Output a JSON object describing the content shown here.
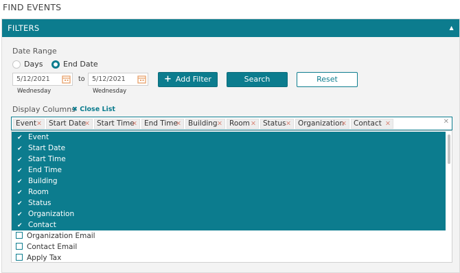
{
  "page_title": "FIND EVENTS",
  "filters": {
    "header": "FILTERS",
    "date_range_label": "Date Range",
    "radio_days": "Days",
    "radio_end_date": "End Date",
    "selected_radio": "End Date",
    "start_date": "5/12/2021",
    "start_weekday": "Wednesday",
    "to_label": "to",
    "end_date": "5/12/2021",
    "end_weekday": "Wednesday",
    "add_filter_label": "Add Filter",
    "search_label": "Search",
    "reset_label": "Reset",
    "display_columns_label": "Display Columns",
    "close_list_label": "Close List"
  },
  "tags": [
    "Event",
    "Start Date",
    "Start Time",
    "End Time",
    "Building",
    "Room",
    "Status",
    "Organization",
    "Contact"
  ],
  "options": [
    {
      "label": "Event",
      "selected": true
    },
    {
      "label": "Start Date",
      "selected": true
    },
    {
      "label": "Start Time",
      "selected": true
    },
    {
      "label": "End Time",
      "selected": true
    },
    {
      "label": "Building",
      "selected": true
    },
    {
      "label": "Room",
      "selected": true
    },
    {
      "label": "Status",
      "selected": true
    },
    {
      "label": "Organization",
      "selected": true
    },
    {
      "label": "Contact",
      "selected": true
    },
    {
      "label": "Organization Email",
      "selected": false
    },
    {
      "label": "Contact Email",
      "selected": false
    },
    {
      "label": "Apply Tax",
      "selected": false
    }
  ],
  "colors": {
    "accent": "#0c7c8e",
    "tag_remove": "#d98a7c",
    "calendar_icon": "#e8a06a"
  }
}
